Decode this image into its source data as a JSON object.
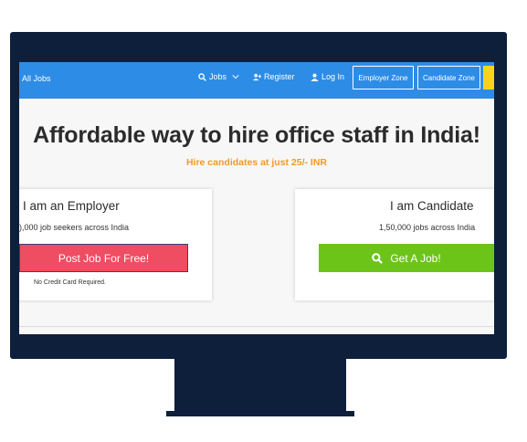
{
  "nav": {
    "all_jobs": "All Jobs",
    "jobs": "Jobs",
    "register": "Register",
    "login": "Log In",
    "employer_zone": "Employer Zone",
    "candidate_zone": "Candidate Zone"
  },
  "hero": {
    "title": "Affordable way to hire office staff in India!",
    "subtitle": "Hire candidates at just 25/- INR"
  },
  "employer_card": {
    "title": "I am an Employer",
    "text": "),000 job seekers across India",
    "button": "Post Job For Free!",
    "note": "No Credit Card Required."
  },
  "candidate_card": {
    "title": "I am Candidate",
    "text": "1,50,000 jobs across India",
    "button": "Get A Job!"
  },
  "colors": {
    "navbar": "#2d8ce6",
    "accent_orange": "#f29a21",
    "post_button": "#ef4d62",
    "get_button": "#6cc419",
    "monitor": "#0e1f3b"
  },
  "icons": [
    "search-icon",
    "chevron-down-icon",
    "add-user-icon",
    "user-icon",
    "search-icon"
  ]
}
